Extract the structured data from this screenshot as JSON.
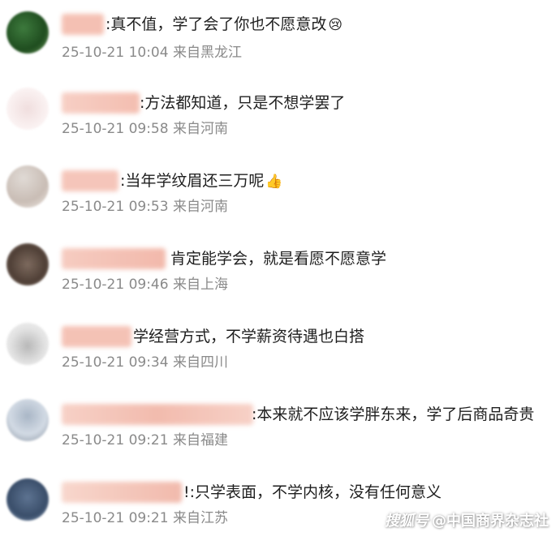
{
  "comments": [
    {
      "text": ":真不值，学了会了你也不愿意改",
      "meta": "25-10-21 10:04 来自黑龙江",
      "emoji": "😢"
    },
    {
      "text": ":方法都知道，只是不想学罢了",
      "meta": "25-10-21 09:58 来自河南"
    },
    {
      "text": ":当年学纹眉还三万呢",
      "meta": "25-10-21 09:53 来自河南",
      "emoji": "👍"
    },
    {
      "text": "肯定能学会，就是看愿不愿意学",
      "meta": "25-10-21 09:46 来自上海"
    },
    {
      "text": "学经营方式，不学薪资待遇也白搭",
      "meta": "25-10-21 09:34 来自四川"
    },
    {
      "text": ":本来就不应该学胖东来，学了后商品奇贵",
      "meta": "25-10-21 09:21 来自福建"
    },
    {
      "text": "!:只学表面，不学内核，没有任何意义",
      "meta": "25-10-21 09:21 来自江苏"
    }
  ],
  "watermark": {
    "brand": "搜狐号",
    "account": "@中国商界杂志社"
  }
}
